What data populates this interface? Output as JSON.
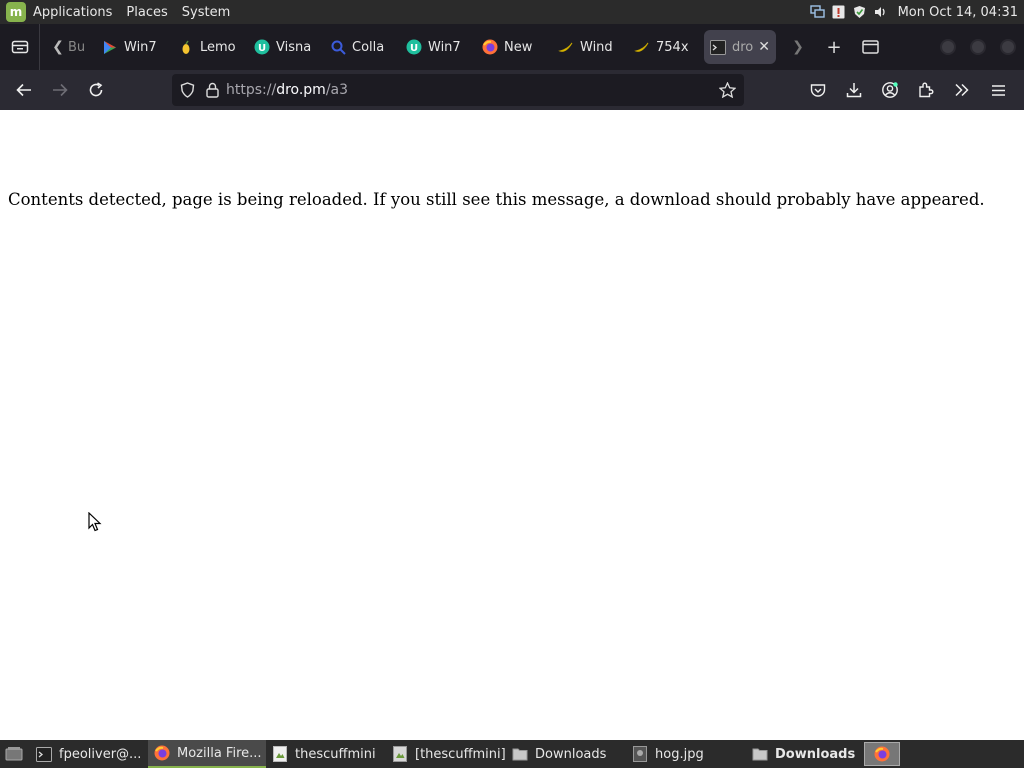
{
  "top_panel": {
    "menus": [
      "Applications",
      "Places",
      "System"
    ],
    "clock": "Mon Oct 14, 04:31"
  },
  "browser": {
    "tabs": [
      {
        "label": "Bu",
        "icon": "doc-icon"
      },
      {
        "label": "Win7",
        "icon": "play-store-icon"
      },
      {
        "label": "Lemo",
        "icon": "lemon-icon"
      },
      {
        "label": "Visna",
        "icon": "u-badge-icon"
      },
      {
        "label": "Colla",
        "icon": "search-icon"
      },
      {
        "label": "Win7",
        "icon": "u-badge-icon"
      },
      {
        "label": "New",
        "icon": "firefox-icon"
      },
      {
        "label": "Wind",
        "icon": "banana-icon"
      },
      {
        "label": "754x",
        "icon": "banana-icon"
      },
      {
        "label": "dro",
        "icon": "terminal-icon",
        "active": true
      }
    ],
    "url": {
      "scheme": "https://",
      "host": "dro.pm",
      "path": "/a3"
    }
  },
  "page": {
    "message": "Contents detected, page is being reloaded. If you still see this message, a download should probably have appeared."
  },
  "taskbar": {
    "items": [
      {
        "label": "fpeoliver@...",
        "icon": "terminal-icon"
      },
      {
        "label": "Mozilla Fire...",
        "icon": "firefox-icon",
        "active": true
      },
      {
        "label": "thescuffmini",
        "icon": "image-viewer-icon"
      },
      {
        "label": "[thescuffmini]",
        "icon": "image-viewer-icon"
      },
      {
        "label": "Downloads",
        "icon": "folder-icon"
      },
      {
        "label": "hog.jpg",
        "icon": "image-file-icon"
      },
      {
        "label": "Downloads",
        "icon": "folder-icon",
        "bold": true
      }
    ]
  },
  "colors": {
    "panel_bg": "#2b2b2b",
    "tabstrip_bg": "#1c1b22",
    "navbar_bg": "#2b2a33",
    "mint_green": "#87b34d"
  }
}
